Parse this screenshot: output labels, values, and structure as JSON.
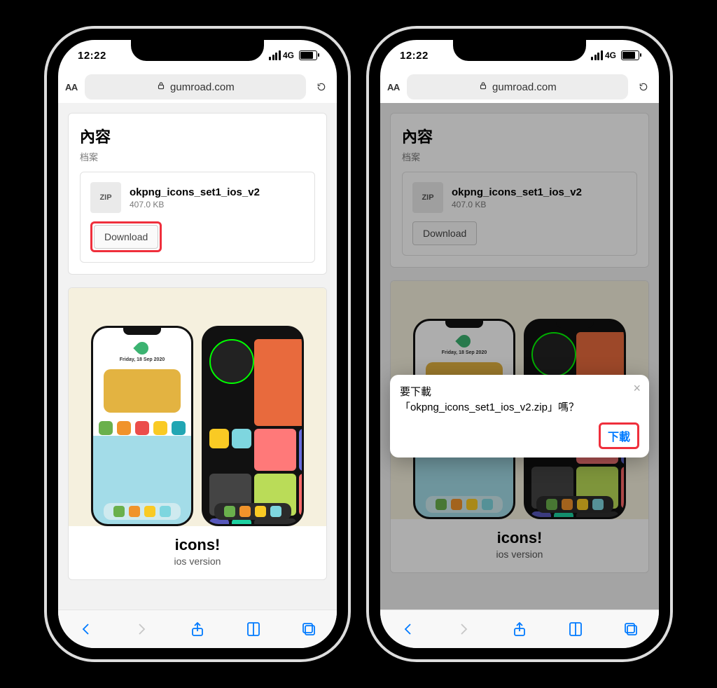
{
  "statusbar": {
    "time": "12:22",
    "network": "4G"
  },
  "browser": {
    "aa": "AA",
    "domain": "gumroad.com"
  },
  "page": {
    "section_title": "內容",
    "section_sub": "档案",
    "file": {
      "badge": "ZIP",
      "name": "okpng_icons_set1_ios_v2",
      "size": "407.0 KB"
    },
    "download_label": "Download",
    "product": {
      "title": "icons!",
      "sub": "ios version",
      "banner_date": "Friday, 18 Sep 2020"
    }
  },
  "prompt": {
    "line1": "要下載",
    "line2": "「okpng_icons_set1_ios_v2.zip」嗎？",
    "action": "下載"
  },
  "colors": {
    "ios_blue": "#007aff",
    "highlight": "#ef2f3c"
  }
}
